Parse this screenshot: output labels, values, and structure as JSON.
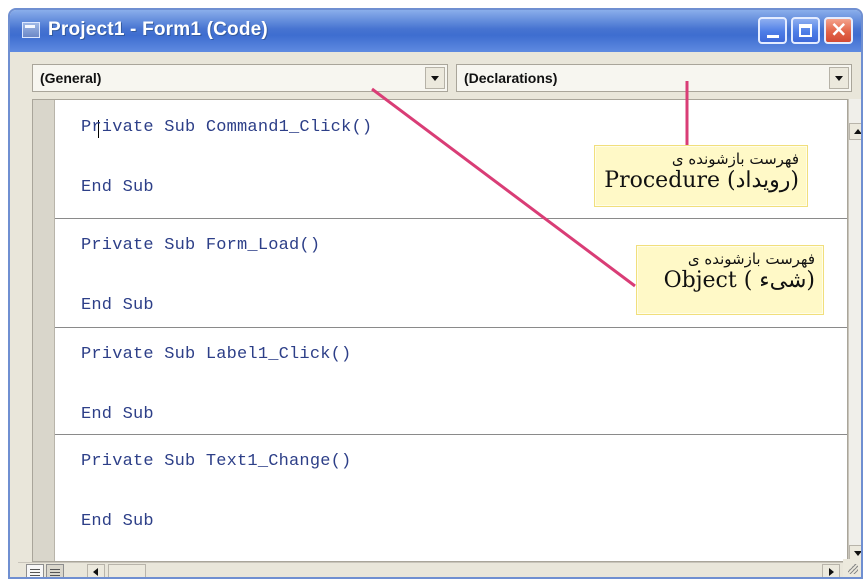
{
  "window": {
    "title": "Project1 - Form1 (Code)"
  },
  "dropdowns": {
    "object": {
      "selected": "(General)"
    },
    "procedure": {
      "selected": "(Declarations)"
    }
  },
  "code": {
    "blocks": [
      {
        "sub": "Private Sub Command1_Click()",
        "end": "End Sub"
      },
      {
        "sub": "Private Sub Form_Load()",
        "end": "End Sub"
      },
      {
        "sub": "Private Sub Label1_Click()",
        "end": "End Sub"
      },
      {
        "sub": "Private Sub Text1_Change()",
        "end": "End Sub"
      }
    ]
  },
  "annotations": {
    "procedure": {
      "line1": "فهرست بازشونده ی",
      "line2": "Procedure (رویداد)"
    },
    "object": {
      "line1": "فهرست بازشونده ی",
      "line2": "Object ( شیء)"
    }
  },
  "colors": {
    "titlebar": "#3e6dd0",
    "code_text": "#2d3f88",
    "annotation_bg": "#fff9c7",
    "annotation_line": "#d93d76"
  },
  "icons": {
    "window_icon": "code-window-icon",
    "minimize": "minimize-icon",
    "maximize": "maximize-icon",
    "close": "close-icon",
    "dropdown_arrow": "chevron-down-icon",
    "procedure_view": "procedure-view-icon",
    "full_module_view": "full-module-view-icon"
  }
}
